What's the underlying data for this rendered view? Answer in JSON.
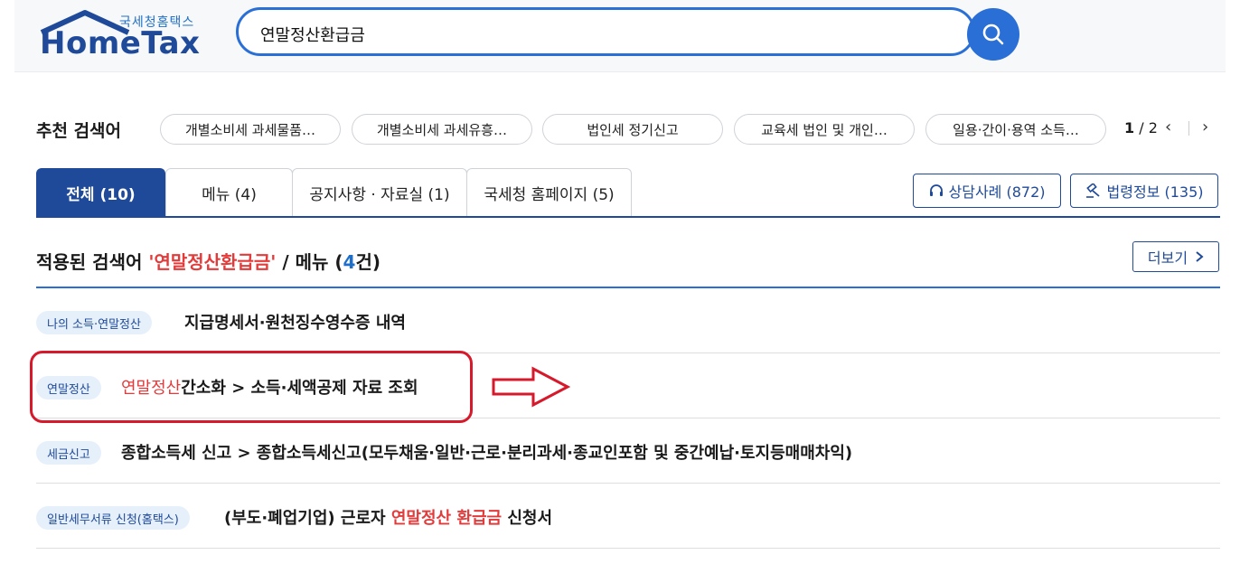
{
  "header": {
    "logo_small": "국세청홈택스",
    "logo_big": "HomeTax",
    "search_value": "연말정산환급금",
    "search_icon": "search-icon"
  },
  "recommend": {
    "label": "추천 검색어",
    "chips": [
      "개별소비세 과세물품…",
      "개별소비세 과세유흥…",
      "법인세 정기신고",
      "교육세 법인 및 개인…",
      "일용·간이·용역 소득…"
    ],
    "page_current": "1",
    "page_total": "/ 2",
    "prev": "‹",
    "next": "›"
  },
  "tabs": [
    {
      "label": "전체 (10)"
    },
    {
      "label": "메뉴 (4)"
    },
    {
      "label": "공지사항 · 자료실 (1)"
    },
    {
      "label": "국세청 홈페이지 (5)"
    }
  ],
  "side_buttons": {
    "consult": "상담사례 (872)",
    "law": "법령정보 (135)"
  },
  "applied": {
    "prefix": "적용된 검색어 ",
    "keyword": "'연말정산환급금'",
    "middle": " / 메뉴 (",
    "count": "4",
    "suffix": "건)",
    "more": "더보기"
  },
  "results": [
    {
      "badge": "나의 소득·연말정산",
      "pre": "지급명세서·원천징수영수증 내역",
      "hl": "",
      "post": ""
    },
    {
      "badge": "연말정산",
      "pre": "",
      "hl": "연말정산",
      "post": "간소화 > 소득·세액공제 자료 조회"
    },
    {
      "badge": "세금신고",
      "pre": "종합소득세 신고 > 종합소득세신고(모두채움·일반·근로·분리과세·종교인포함 및 중간예납·토지등매매차익)",
      "hl": "",
      "post": ""
    },
    {
      "badge": "일반세무서류 신청(홈택스)",
      "pre": "(부도·폐업기업) 근로자 ",
      "hl": "연말정산 환급금",
      "post": " 신청서"
    }
  ]
}
